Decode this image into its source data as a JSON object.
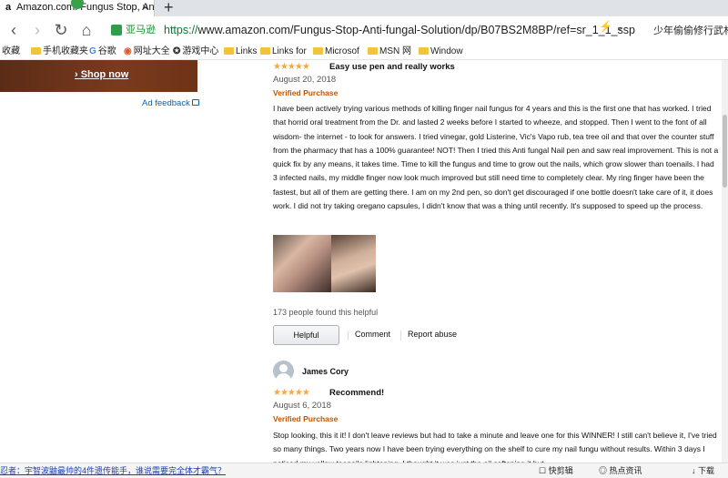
{
  "browser": {
    "tab": {
      "favicon": "a",
      "title": "Amazon.com: Fungus Stop, Anti",
      "close": "×"
    },
    "new_tab": "+",
    "nav": {
      "back": "‹",
      "forward": "›",
      "reload": "↻",
      "home": "⌂"
    },
    "site_pill": "亚马逊",
    "url_scheme": "https://",
    "url_rest": "www.amazon.com/Fungus-Stop-Anti-fungal-Solution/dp/B07BS2M8BP/ref=sr_1_1_ssp",
    "url_icons": "⚡ ⌄",
    "hot_search": "少年偷偷修行武林",
    "bookmarks": [
      {
        "label": "收藏",
        "kind": "text"
      },
      {
        "label": "手机收藏夹",
        "kind": "folder"
      },
      {
        "label": "谷歌",
        "kind": "glyph",
        "glyph": "G"
      },
      {
        "label": "网址大全",
        "kind": "glyph",
        "glyph": "◉"
      },
      {
        "label": "游戏中心",
        "kind": "glyph",
        "glyph": "✪"
      },
      {
        "label": "Links",
        "kind": "folder"
      },
      {
        "label": "Links for",
        "kind": "folder"
      },
      {
        "label": "Microsof",
        "kind": "folder"
      },
      {
        "label": "MSN 网",
        "kind": "folder"
      },
      {
        "label": "Window",
        "kind": "folder"
      }
    ]
  },
  "ad": {
    "shop_now": "› Shop now",
    "feedback": "Ad feedback"
  },
  "reviews": [
    {
      "stars": "★★★★★",
      "title": "Easy use pen and really works",
      "date": "August 20, 2018",
      "verified": "Verified Purchase",
      "body": "I have been actively trying various methods of killing finger nail fungus for 4 years and this is the first one that has worked. I tried that horrid oral treatment from the Dr. and lasted 2 weeks before I started to wheeze, and stopped. Then I went to the font of all wisdom- the internet - to look for answers. I tried vinegar, gold Listerine, Vic's Vapo rub, tea tree oil and that over the counter stuff from the pharmacy that has a 100% guarantee! NOT! Then I tried this Anti fungal Nail pen and saw real improvement. This is not a quick fix by any means, it takes time. Time to kill the fungus and time to grow out the nails, which grow slower than toenails. I had 3 infected nails, my middle finger now look much improved but still need time to completely clear. My ring finger have been the fastest, but all of them are getting there. I am on my 2nd pen, so don't get discouraged if one bottle doesn't take care of it, it does work. I did not try taking oregano capsules, I didn't know that was a thing until recently. It's supposed to speed up the process.",
      "helpful_count": "173 people found this helpful",
      "helpful_button": "Helpful",
      "comment": "Comment",
      "report": "Report abuse"
    },
    {
      "reviewer": "James Cory",
      "stars": "★★★★★",
      "title": "Recommend!",
      "date": "August 6, 2018",
      "verified": "Verified Purchase",
      "body": "Stop looking, this it it! I don't leave reviews but had to take a minute and leave one for this WINNER! I still can't believe it, I've tried so many things. Two years now I have been trying everything on the shelf to cure my nail fungu without results. Within 3 days I noticed my yellow toenails lightening. I thought it was just the oil softening it but"
    }
  ],
  "statusbar": {
    "ticker": "忍者：宇智波鼬最帅的4件遗传能手，谁说需要完全体才霸气？",
    "items": [
      {
        "icon": "☐",
        "label": "快剪辑"
      },
      {
        "icon": "◎",
        "label": "热点资讯"
      },
      {
        "icon": "↓",
        "label": "下载"
      }
    ]
  },
  "colors": {
    "link": "#0066c0",
    "verified": "#c45500",
    "stars": "#f3a847",
    "secure_green": "#0a7a2f"
  }
}
